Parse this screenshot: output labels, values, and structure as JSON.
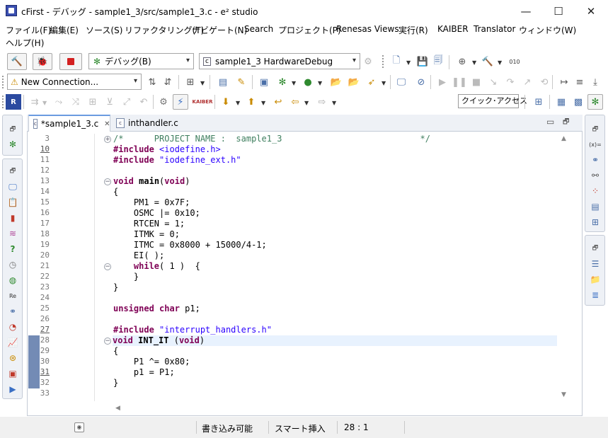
{
  "window": {
    "title": "cFirst - デバッグ - sample1_3/src/sample1_3.c - e² studio",
    "minimize_glyph": "—",
    "maximize_glyph": "☐",
    "close_glyph": "✕"
  },
  "menu": [
    "ファイル(F)",
    "編集(E)",
    "ソース(S)",
    "リファクタリング(T)",
    "ナビゲート(N)",
    "Search",
    "プロジェクト(P)",
    "Renesas Views",
    "実行(R)",
    "KAIBER",
    "Translator",
    "ウィンドウ(W)",
    "ヘルプ(H)"
  ],
  "toolbar": {
    "launch_mode": "デバッグ(B)",
    "launch_config": "sample1_3 HardwareDebug",
    "connection": "New Connection...",
    "quick_access": "クイック･アクセス",
    "kaiber_label": "KAIBER"
  },
  "tabs": [
    {
      "label": "*sample1_3.c",
      "close": "✕",
      "icon_text": "c"
    },
    {
      "label": "inthandler.c",
      "icon_text": "c"
    }
  ],
  "editor": {
    "lines": [
      {
        "n": "3",
        "underline": false
      },
      {
        "n": "10",
        "underline": true
      },
      {
        "n": "11",
        "underline": false
      },
      {
        "n": "12",
        "underline": false
      },
      {
        "n": "13",
        "underline": false
      },
      {
        "n": "14",
        "underline": false
      },
      {
        "n": "15",
        "underline": false
      },
      {
        "n": "16",
        "underline": false
      },
      {
        "n": "17",
        "underline": false
      },
      {
        "n": "18",
        "underline": false
      },
      {
        "n": "19",
        "underline": false
      },
      {
        "n": "20",
        "underline": false
      },
      {
        "n": "21",
        "underline": false
      },
      {
        "n": "22",
        "underline": false
      },
      {
        "n": "23",
        "underline": false
      },
      {
        "n": "24",
        "underline": false
      },
      {
        "n": "25",
        "underline": false
      },
      {
        "n": "26",
        "underline": false
      },
      {
        "n": "27",
        "underline": true
      },
      {
        "n": "28",
        "underline": false
      },
      {
        "n": "29",
        "underline": false
      },
      {
        "n": "30",
        "underline": false
      },
      {
        "n": "31",
        "underline": true
      },
      {
        "n": "32",
        "underline": false
      },
      {
        "n": "33",
        "underline": false
      }
    ],
    "code": [
      "/*      PROJECT NAME :  sample1_3                           */",
      "#include <iodefine.h>",
      "#include \"iodefine_ext.h\"",
      "",
      "void main(void)",
      "{",
      "    PM1 = 0x7F;",
      "    OSMC |= 0x10;",
      "    RTCEN = 1;",
      "    ITMK = 0;",
      "    ITMC = 0x8000 + 15000/4-1;",
      "    EI( );",
      "    while( 1 )  {",
      "    }",
      "}",
      "",
      "unsigned char p1;",
      "",
      "#include \"interrupt_handlers.h\"",
      "void INT_IT (void)",
      "{",
      "    P1 ^= 0x80;",
      "    p1 = P1;",
      "}",
      ""
    ]
  },
  "status": {
    "writable": "書き込み可能",
    "insert_mode": "スマート挿入",
    "position": "28 : 1"
  },
  "colors": {
    "keyword": "#7f0055",
    "string": "#2a00ff",
    "comment": "#3f7f5f",
    "current_line": "#e8f2fe",
    "tab_accent": "#6b9be0"
  }
}
